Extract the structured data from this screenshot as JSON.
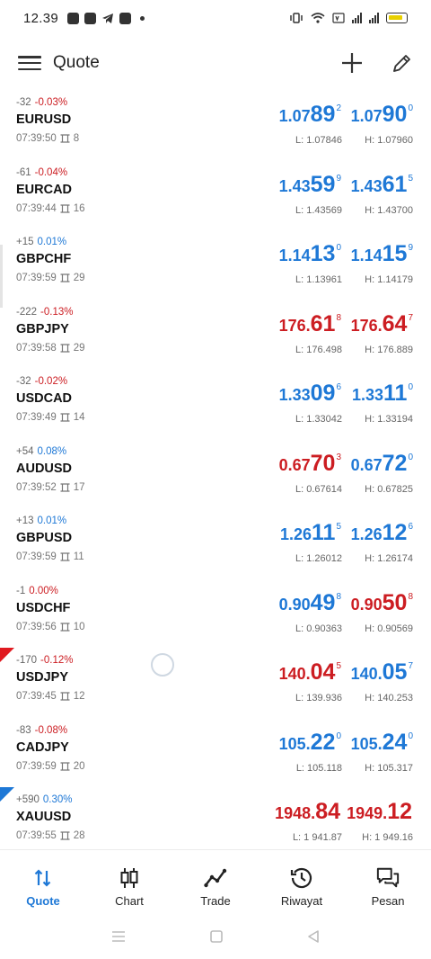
{
  "status_bar": {
    "time": "12.39"
  },
  "header": {
    "title": "Quote"
  },
  "quotes": [
    {
      "change_points": "-32",
      "change_pct": "-0.03%",
      "pct_color": "red",
      "symbol": "EURUSD",
      "time": "07:39:50",
      "spread": "8",
      "bid": {
        "pre": "1.07",
        "big": "89",
        "sup": "2",
        "color": "blue"
      },
      "ask": {
        "pre": "1.07",
        "big": "90",
        "sup": "0",
        "color": "blue"
      },
      "low": "L: 1.07846",
      "high": "H: 1.07960"
    },
    {
      "change_points": "-61",
      "change_pct": "-0.04%",
      "pct_color": "red",
      "symbol": "EURCAD",
      "time": "07:39:44",
      "spread": "16",
      "bid": {
        "pre": "1.43",
        "big": "59",
        "sup": "9",
        "color": "blue"
      },
      "ask": {
        "pre": "1.43",
        "big": "61",
        "sup": "5",
        "color": "blue"
      },
      "low": "L: 1.43569",
      "high": "H: 1.43700"
    },
    {
      "change_points": "+15",
      "change_pct": "0.01%",
      "pct_color": "blue",
      "symbol": "GBPCHF",
      "time": "07:39:59",
      "spread": "29",
      "bid": {
        "pre": "1.14",
        "big": "13",
        "sup": "0",
        "color": "blue"
      },
      "ask": {
        "pre": "1.14",
        "big": "15",
        "sup": "9",
        "color": "blue"
      },
      "low": "L: 1.13961",
      "high": "H: 1.14179"
    },
    {
      "change_points": "-222",
      "change_pct": "-0.13%",
      "pct_color": "red",
      "symbol": "GBPJPY",
      "time": "07:39:58",
      "spread": "29",
      "bid": {
        "pre": "176.",
        "big": "61",
        "sup": "8",
        "color": "red"
      },
      "ask": {
        "pre": "176.",
        "big": "64",
        "sup": "7",
        "color": "red"
      },
      "low": "L: 176.498",
      "high": "H: 176.889"
    },
    {
      "change_points": "-32",
      "change_pct": "-0.02%",
      "pct_color": "red",
      "symbol": "USDCAD",
      "time": "07:39:49",
      "spread": "14",
      "bid": {
        "pre": "1.33",
        "big": "09",
        "sup": "6",
        "color": "blue"
      },
      "ask": {
        "pre": "1.33",
        "big": "11",
        "sup": "0",
        "color": "blue"
      },
      "low": "L: 1.33042",
      "high": "H: 1.33194"
    },
    {
      "change_points": "+54",
      "change_pct": "0.08%",
      "pct_color": "blue",
      "symbol": "AUDUSD",
      "time": "07:39:52",
      "spread": "17",
      "bid": {
        "pre": "0.67",
        "big": "70",
        "sup": "3",
        "color": "red"
      },
      "ask": {
        "pre": "0.67",
        "big": "72",
        "sup": "0",
        "color": "blue"
      },
      "low": "L: 0.67614",
      "high": "H: 0.67825"
    },
    {
      "change_points": "+13",
      "change_pct": "0.01%",
      "pct_color": "blue",
      "symbol": "GBPUSD",
      "time": "07:39:59",
      "spread": "11",
      "bid": {
        "pre": "1.26",
        "big": "11",
        "sup": "5",
        "color": "blue"
      },
      "ask": {
        "pre": "1.26",
        "big": "12",
        "sup": "6",
        "color": "blue"
      },
      "low": "L: 1.26012",
      "high": "H: 1.26174"
    },
    {
      "change_points": "-1",
      "change_pct": "0.00%",
      "pct_color": "red",
      "symbol": "USDCHF",
      "time": "07:39:56",
      "spread": "10",
      "bid": {
        "pre": "0.90",
        "big": "49",
        "sup": "8",
        "color": "blue"
      },
      "ask": {
        "pre": "0.90",
        "big": "50",
        "sup": "8",
        "color": "red"
      },
      "low": "L: 0.90363",
      "high": "H: 0.90569"
    },
    {
      "change_points": "-170",
      "change_pct": "-0.12%",
      "pct_color": "red",
      "symbol": "USDJPY",
      "time": "07:39:45",
      "spread": "12",
      "marker": "red",
      "bid": {
        "pre": "140.",
        "big": "04",
        "sup": "5",
        "color": "red"
      },
      "ask": {
        "pre": "140.",
        "big": "05",
        "sup": "7",
        "color": "blue"
      },
      "low": "L: 139.936",
      "high": "H: 140.253"
    },
    {
      "change_points": "-83",
      "change_pct": "-0.08%",
      "pct_color": "red",
      "symbol": "CADJPY",
      "time": "07:39:59",
      "spread": "20",
      "bid": {
        "pre": "105.",
        "big": "22",
        "sup": "0",
        "color": "blue"
      },
      "ask": {
        "pre": "105.",
        "big": "24",
        "sup": "0",
        "color": "blue"
      },
      "low": "L: 105.118",
      "high": "H: 105.317"
    },
    {
      "change_points": "+590",
      "change_pct": "0.30%",
      "pct_color": "blue",
      "symbol": "XAUUSD",
      "time": "07:39:55",
      "spread": "28",
      "marker": "blue",
      "bid": {
        "pre": "1948.",
        "big": "84",
        "sup": "",
        "color": "red"
      },
      "ask": {
        "pre": "1949.",
        "big": "12",
        "sup": "",
        "color": "red"
      },
      "low": "L: 1 941.87",
      "high": "H: 1 949.16"
    }
  ],
  "bottom_nav": [
    {
      "label": "Quote",
      "icon": "quote-arrows-icon",
      "active": true
    },
    {
      "label": "Chart",
      "icon": "candlestick-icon",
      "active": false
    },
    {
      "label": "Trade",
      "icon": "trade-line-icon",
      "active": false
    },
    {
      "label": "Riwayat",
      "icon": "history-icon",
      "active": false
    },
    {
      "label": "Pesan",
      "icon": "messages-icon",
      "active": false
    }
  ],
  "colors": {
    "blue": "#1e78d6",
    "red": "#cc1d22",
    "marker_red": "#e01a20"
  }
}
